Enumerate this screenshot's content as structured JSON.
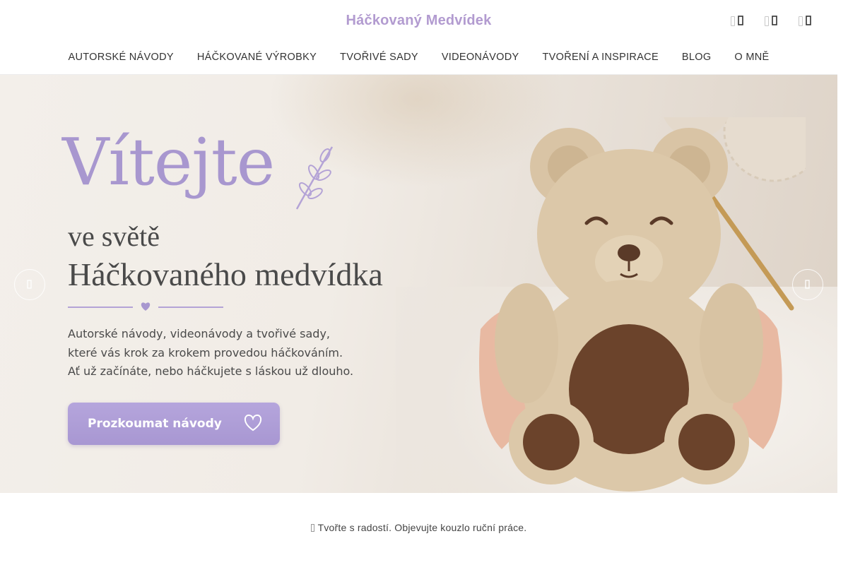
{
  "site": {
    "title": "Háčkovaný Medvídek"
  },
  "header_icons": [
    {
      "name": "search-icon"
    },
    {
      "name": "user-icon"
    },
    {
      "name": "cart-icon"
    }
  ],
  "nav": {
    "items": [
      "AUTORSKÉ NÁVODY",
      "HÁČKOVANÉ VÝROBKY",
      "TVOŘIVÉ SADY",
      "VIDEONÁVODY",
      "TVOŘENÍ A INSPIRACE",
      "BLOG",
      "O MNĚ"
    ]
  },
  "hero": {
    "welcome": "Vítejte",
    "line1": "ve světě",
    "line2": "Háčkovaného medvídka",
    "description": [
      "Autorské návody, videonávody a tvořivé sady,",
      "které vás krok za krokem provedou háčkováním.",
      "Ať už začínáte, nebo háčkujete s láskou už dlouho."
    ],
    "cta_label": "Prozkoumat návody",
    "accent_color": "#a897cf",
    "prev_icon": "chevron-left-icon",
    "next_icon": "chevron-right-icon"
  },
  "tagline": "Tvořte s radostí. Objevujte kouzlo ruční práce."
}
